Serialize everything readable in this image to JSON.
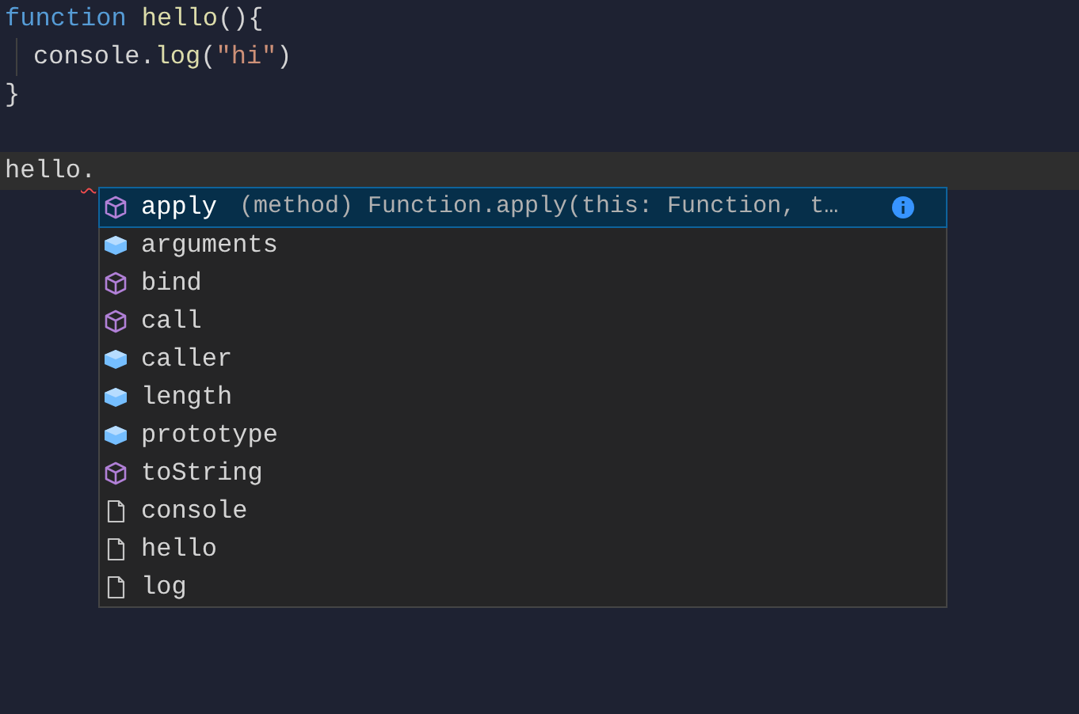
{
  "editor": {
    "lines": [
      {
        "indent": false,
        "current": false,
        "tokens": [
          {
            "text": "function ",
            "kind": "keyword"
          },
          {
            "text": "hello",
            "kind": "function"
          },
          {
            "text": "(){",
            "kind": "plain"
          }
        ]
      },
      {
        "indent": true,
        "current": false,
        "tokens": [
          {
            "text": "console.",
            "kind": "plain"
          },
          {
            "text": "log",
            "kind": "function"
          },
          {
            "text": "(",
            "kind": "plain"
          },
          {
            "text": "\"hi\"",
            "kind": "string"
          },
          {
            "text": ")",
            "kind": "plain"
          }
        ]
      },
      {
        "indent": false,
        "current": false,
        "tokens": [
          {
            "text": "}",
            "kind": "plain"
          }
        ]
      },
      {
        "indent": false,
        "current": false
      },
      {
        "indent": false,
        "current": true,
        "tokens": [
          {
            "text": "hello",
            "kind": "plain"
          },
          {
            "text": ".",
            "kind": "error"
          }
        ]
      }
    ]
  },
  "suggestions": {
    "items": [
      {
        "label": "apply",
        "kind": "method",
        "selected": true,
        "detail": "(method) Function.apply(this: Function, t…"
      },
      {
        "label": "arguments",
        "kind": "field",
        "selected": false
      },
      {
        "label": "bind",
        "kind": "method",
        "selected": false
      },
      {
        "label": "call",
        "kind": "method",
        "selected": false
      },
      {
        "label": "caller",
        "kind": "field",
        "selected": false
      },
      {
        "label": "length",
        "kind": "field",
        "selected": false
      },
      {
        "label": "prototype",
        "kind": "field",
        "selected": false
      },
      {
        "label": "toString",
        "kind": "method",
        "selected": false
      },
      {
        "label": "console",
        "kind": "text",
        "selected": false
      },
      {
        "label": "hello",
        "kind": "text",
        "selected": false
      },
      {
        "label": "log",
        "kind": "text",
        "selected": false
      }
    ]
  }
}
